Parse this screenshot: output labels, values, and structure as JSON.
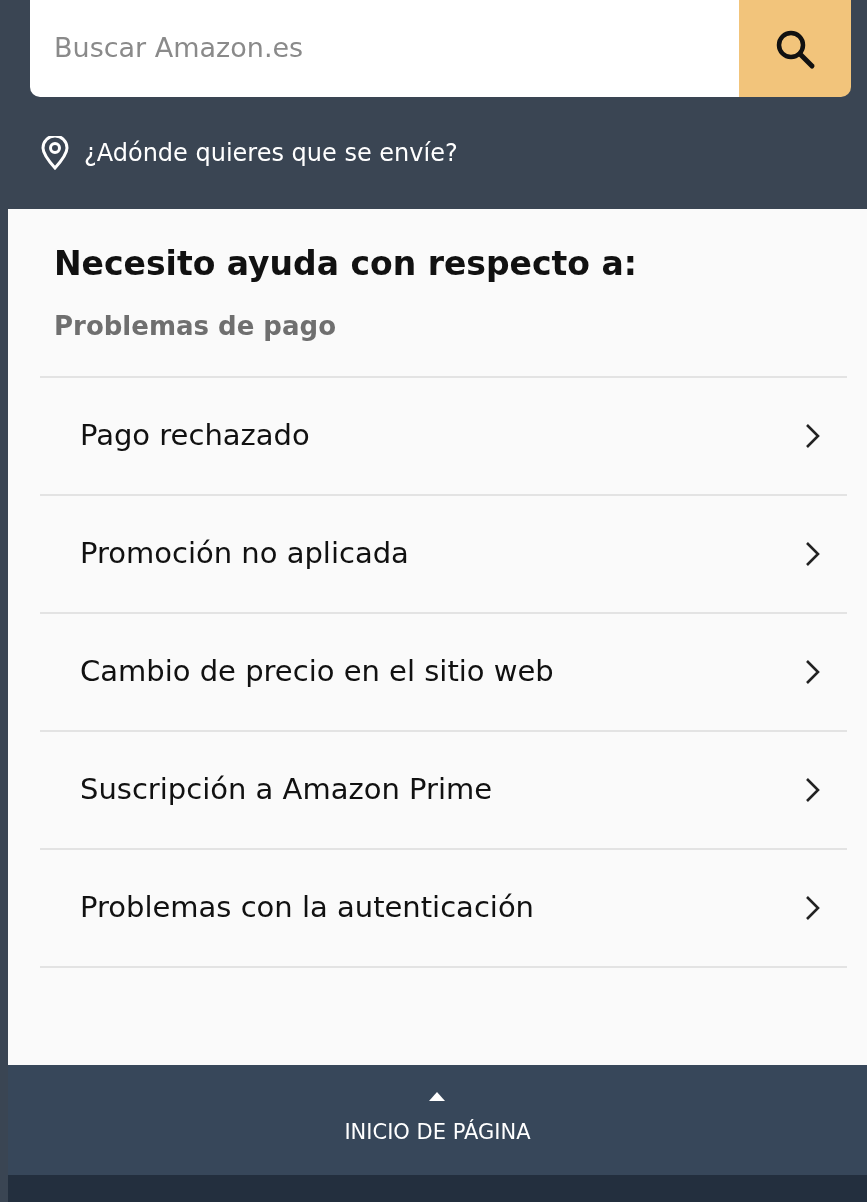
{
  "search": {
    "placeholder": "Buscar Amazon.es"
  },
  "location": {
    "label": "¿Adónde quieres que se envíe?"
  },
  "help": {
    "heading": "Necesito ayuda con respecto a:",
    "subtitle": "Problemas de pago",
    "items": [
      {
        "label": "Pago rechazado"
      },
      {
        "label": "Promoción no aplicada"
      },
      {
        "label": "Cambio de precio en el sitio web"
      },
      {
        "label": "Suscripción a Amazon Prime"
      },
      {
        "label": "Problemas con la autenticación"
      }
    ]
  },
  "footer": {
    "back_to_top": "INICIO DE PÁGINA"
  }
}
